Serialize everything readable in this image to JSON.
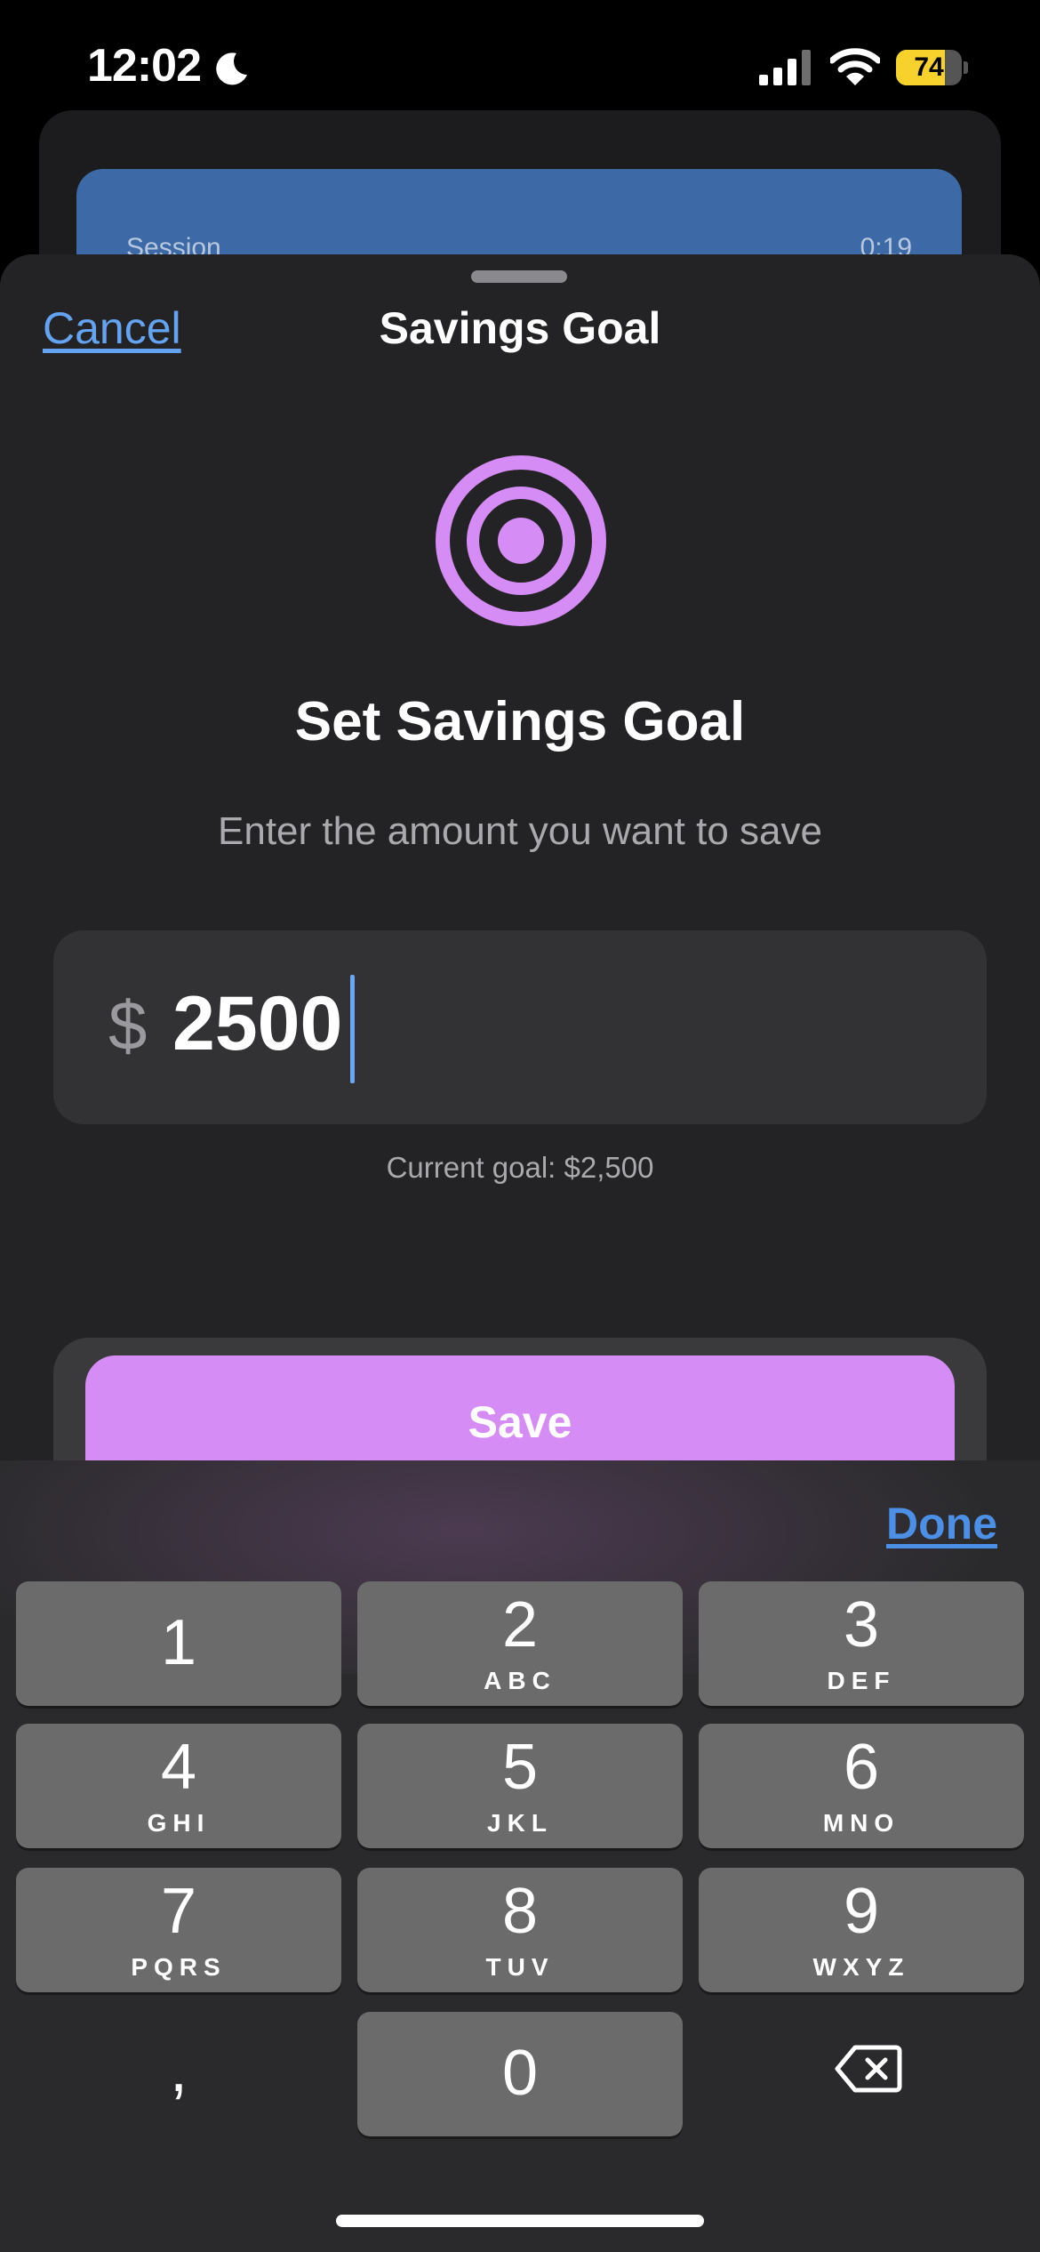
{
  "status_bar": {
    "time": "12:02",
    "battery": "74",
    "battery_level": 0.74
  },
  "background": {
    "session_label": "Session",
    "session_time": "0:19"
  },
  "sheet": {
    "cancel_label": "Cancel",
    "title": "Savings Goal",
    "icon": "target-icon",
    "heading": "Set Savings Goal",
    "subtitle": "Enter the amount you want to save",
    "currency_symbol": "$",
    "amount_value": "2500",
    "current_goal": "Current goal: $2,500",
    "save_label": "Save"
  },
  "keyboard": {
    "done_label": "Done",
    "keys": [
      {
        "digit": "1",
        "letters": ""
      },
      {
        "digit": "2",
        "letters": "ABC"
      },
      {
        "digit": "3",
        "letters": "DEF"
      },
      {
        "digit": "4",
        "letters": "GHI"
      },
      {
        "digit": "5",
        "letters": "JKL"
      },
      {
        "digit": "6",
        "letters": "MNO"
      },
      {
        "digit": "7",
        "letters": "PQRS"
      },
      {
        "digit": "8",
        "letters": "TUV"
      },
      {
        "digit": "9",
        "letters": "WXYZ"
      },
      {
        "digit": "0",
        "letters": ""
      }
    ],
    "comma_label": ",",
    "delete_icon": "delete-backspace-icon"
  },
  "colors": {
    "accent_purple": "#d68cf5",
    "link_blue": "#64a3ef",
    "done_blue": "#4c8fe6",
    "battery_yellow": "#f7d22c"
  }
}
